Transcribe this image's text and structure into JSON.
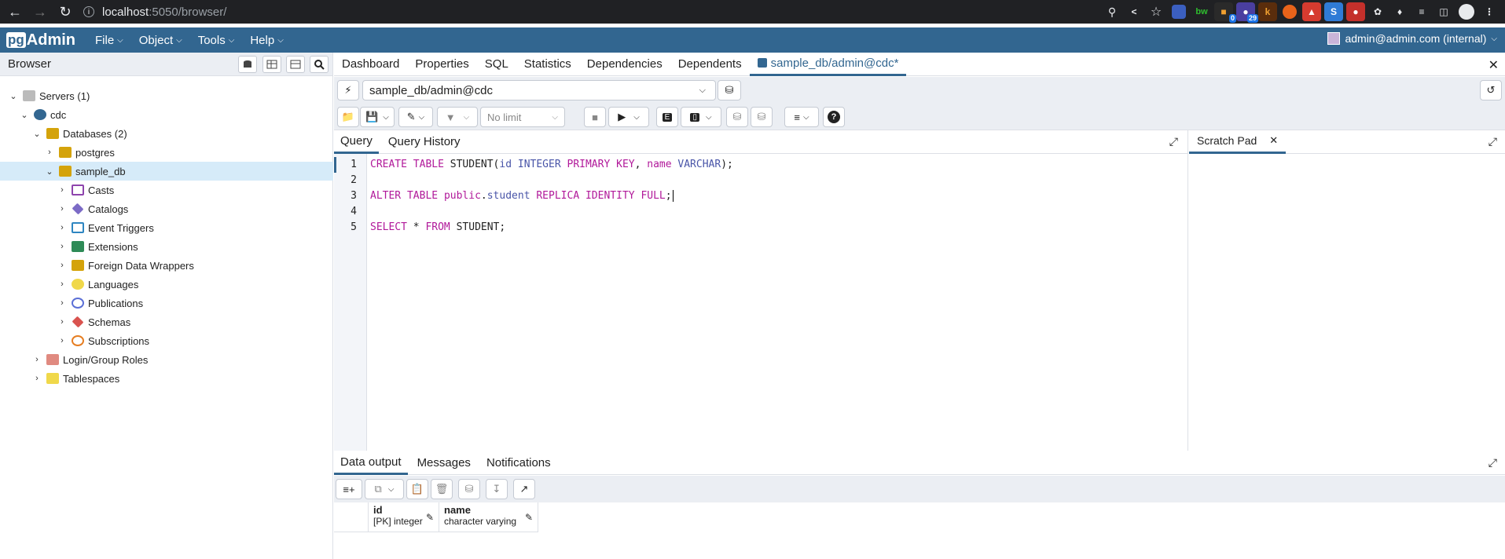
{
  "browser": {
    "url_host": "localhost",
    "url_path": ":5050/browser/",
    "extension_badges": [
      "0",
      "29"
    ]
  },
  "menu": {
    "logo_box": "pg",
    "logo_text": "Admin",
    "items": [
      "File",
      "Object",
      "Tools",
      "Help"
    ],
    "user": "admin@admin.com (internal)"
  },
  "sidebar": {
    "title": "Browser",
    "tree": [
      {
        "label": "Servers (1)",
        "icon": "servers-icon",
        "color": "#999999"
      },
      {
        "label": "cdc",
        "icon": "server-icon",
        "color": "#336791"
      },
      {
        "label": "Databases (2)",
        "icon": "databases-icon",
        "color": "#d4a30b"
      },
      {
        "label": "postgres",
        "icon": "database-icon",
        "color": "#d4a30b"
      },
      {
        "label": "sample_db",
        "icon": "database-icon",
        "color": "#d4a30b"
      },
      {
        "label": "Casts",
        "icon": "casts-icon",
        "color": "#8e44ad"
      },
      {
        "label": "Catalogs",
        "icon": "catalogs-icon",
        "color": "#7c6bc6"
      },
      {
        "label": "Event Triggers",
        "icon": "event-triggers-icon",
        "color": "#2e86c1"
      },
      {
        "label": "Extensions",
        "icon": "extensions-icon",
        "color": "#2e8b57"
      },
      {
        "label": "Foreign Data Wrappers",
        "icon": "fdw-icon",
        "color": "#d4a30b"
      },
      {
        "label": "Languages",
        "icon": "languages-icon",
        "color": "#e5c300"
      },
      {
        "label": "Publications",
        "icon": "publications-icon",
        "color": "#5b6fd6"
      },
      {
        "label": "Schemas",
        "icon": "schemas-icon",
        "color": "#d9534f"
      },
      {
        "label": "Subscriptions",
        "icon": "subscriptions-icon",
        "color": "#e67e22"
      },
      {
        "label": "Login/Group Roles",
        "icon": "roles-icon",
        "color": "#c0392b"
      },
      {
        "label": "Tablespaces",
        "icon": "tablespaces-icon",
        "color": "#d4a30b"
      }
    ]
  },
  "tabs": [
    "Dashboard",
    "Properties",
    "SQL",
    "Statistics",
    "Dependencies",
    "Dependents"
  ],
  "active_tab": "sample_db/admin@cdc*",
  "connection": "sample_db/admin@cdc",
  "limit": "No limit",
  "query_tabs": [
    "Query",
    "Query History"
  ],
  "scratch_pad": "Scratch Pad",
  "editor": {
    "line_numbers": [
      "1",
      "2",
      "3",
      "4",
      "5"
    ]
  },
  "output_tabs": [
    "Data output",
    "Messages",
    "Notifications"
  ],
  "grid": {
    "columns": [
      {
        "name": "id",
        "type": "[PK] integer"
      },
      {
        "name": "name",
        "type": "character varying"
      }
    ]
  }
}
